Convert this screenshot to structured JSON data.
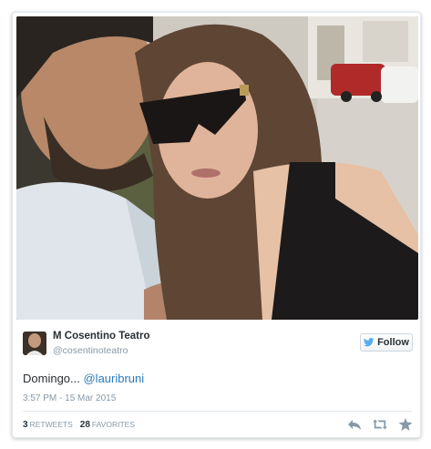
{
  "tweet": {
    "author_name": "M Cosentino Teatro",
    "author_handle": "@cosentinoteatro",
    "follow_label": "Follow",
    "text_prefix": "Domingo... ",
    "mention": "@lauribruni",
    "timestamp": "3:57 PM - 15 Mar 2015",
    "retweets_count": "3",
    "retweets_label": "Retweets",
    "favorites_count": "28",
    "favorites_label": "Favorites"
  },
  "icons": {
    "follow": "twitter-bird-icon",
    "reply": "reply-icon",
    "retweet": "retweet-icon",
    "favorite": "star-icon"
  },
  "colors": {
    "link": "#2b7bb9",
    "muted": "#8899a6",
    "text": "#292f33",
    "bird": "#55acee"
  }
}
